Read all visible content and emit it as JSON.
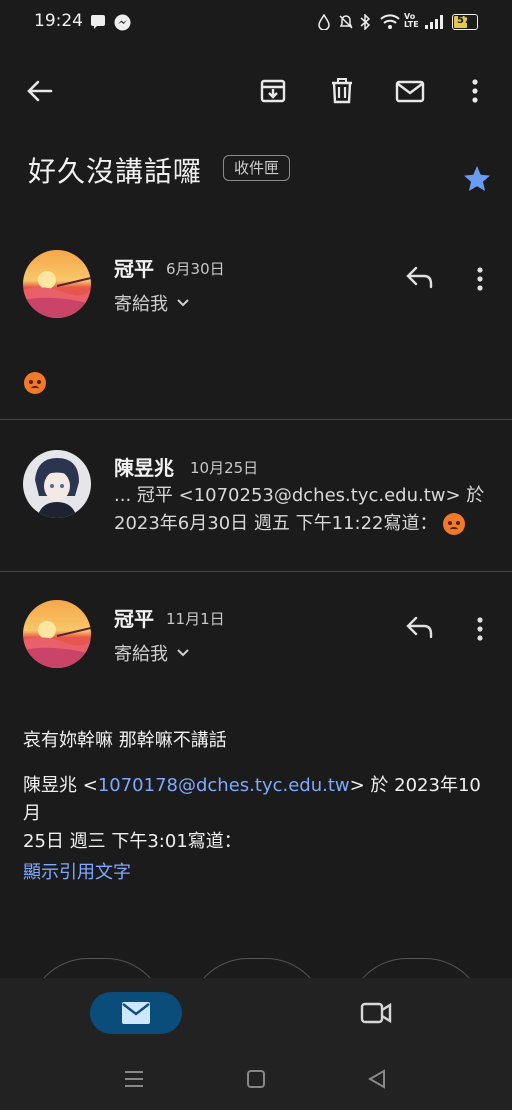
{
  "status_bar": {
    "time": "19:24",
    "battery": "57"
  },
  "toolbar": {
    "back_icon": "arrow-left-icon",
    "archive_icon": "archive-icon",
    "delete_icon": "trash-icon",
    "unread_icon": "mail-icon",
    "more_icon": "more-vert-icon"
  },
  "subject": {
    "title": "好久沒講話囉",
    "label": "收件匣",
    "starred": true,
    "star_color": "#6b9bf0"
  },
  "messages": [
    {
      "sender": "冠平",
      "date": "6月30日",
      "to": "寄給我",
      "body": "😡"
    },
    {
      "sender": "陳昱兆",
      "date": "10月25日",
      "snippet_line1": "... 冠平 <1070253@dches.tyc.edu.tw> 於",
      "snippet_line2": "2023年6月30日 週五 下午11:22寫道："
    },
    {
      "sender": "冠平",
      "date": "11月1日",
      "to": "寄給我",
      "body": "哀有妳幹嘛 那幹嘛不講話",
      "quote_name": "陳昱兆 <",
      "quote_email": "1070178@dches.tyc.edu.tw",
      "quote_after": "> 於 2023年10月",
      "quote_line2": "25日 週三 下午3:01寫道：",
      "show_quoted": "顯示引用文字"
    }
  ],
  "bottom_nav": {
    "mail_icon": "mail-icon",
    "meet_icon": "video-camera-icon"
  },
  "colors": {
    "background": "#1b1b1b",
    "link": "#7fa8ff",
    "nav_active": "#0a4d7a"
  }
}
